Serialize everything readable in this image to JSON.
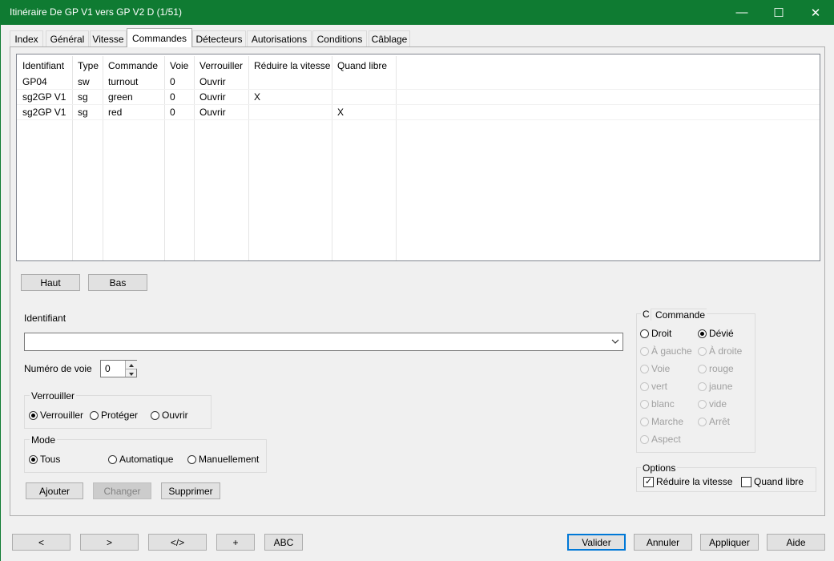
{
  "window": {
    "title": "Itinéraire  De GP V1 vers GP V2 D (1/51)",
    "minimize": "—",
    "maximize": "☐",
    "close": "✕"
  },
  "tabs": [
    {
      "label": "Index"
    },
    {
      "label": "Général"
    },
    {
      "label": "Vitesse"
    },
    {
      "label": "Commandes"
    },
    {
      "label": "Détecteurs"
    },
    {
      "label": "Autorisations"
    },
    {
      "label": "Conditions"
    },
    {
      "label": "Câblage"
    }
  ],
  "table": {
    "headers": [
      "Identifiant",
      "Type",
      "Commande",
      "Voie",
      "Verrouiller",
      "Réduire la vitesse",
      "Quand libre"
    ],
    "rows": [
      [
        "GP04",
        "sw",
        "turnout",
        "0",
        "Ouvrir",
        "",
        ""
      ],
      [
        "sg2GP V1",
        "sg",
        "green",
        "0",
        "Ouvrir",
        "X",
        ""
      ],
      [
        "sg2GP V1",
        "sg",
        "red",
        "0",
        "Ouvrir",
        "",
        "X"
      ]
    ]
  },
  "order_buttons": {
    "up": "Haut",
    "down": "Bas"
  },
  "form": {
    "identifiant_label": "Identifiant",
    "identifiant_value": "",
    "voie_label": "Numéro de voie",
    "voie_value": "0"
  },
  "verrouiller": {
    "title": "Verrouiller",
    "options": [
      "Verrouiller",
      "Protéger",
      "Ouvrir"
    ],
    "selected": "Verrouiller"
  },
  "mode": {
    "title": "Mode",
    "options": [
      "Tous",
      "Automatique",
      "Manuellement"
    ],
    "selected": "Tous"
  },
  "edit_buttons": {
    "add": "Ajouter",
    "change": "Changer",
    "delete": "Supprimer"
  },
  "commande": {
    "title_prefix": "C",
    "title": "Commande",
    "options": [
      {
        "label": "Droit",
        "enabled": true,
        "selected": false
      },
      {
        "label": "Dévié",
        "enabled": true,
        "selected": true
      },
      {
        "label": "À gauche",
        "enabled": false,
        "selected": false
      },
      {
        "label": "À droite",
        "enabled": false,
        "selected": false
      },
      {
        "label": "Voie",
        "enabled": false,
        "selected": false
      },
      {
        "label": "rouge",
        "enabled": false,
        "selected": false
      },
      {
        "label": "vert",
        "enabled": false,
        "selected": false
      },
      {
        "label": "jaune",
        "enabled": false,
        "selected": false
      },
      {
        "label": "blanc",
        "enabled": false,
        "selected": false
      },
      {
        "label": "vide",
        "enabled": false,
        "selected": false
      },
      {
        "label": "Marche",
        "enabled": false,
        "selected": false
      },
      {
        "label": "Arrêt",
        "enabled": false,
        "selected": false
      },
      {
        "label": "Aspect",
        "enabled": false,
        "selected": false
      }
    ]
  },
  "options": {
    "title": "Options",
    "reduce_speed": {
      "label": "Réduire la vitesse",
      "checked": true
    },
    "when_free": {
      "label": "Quand libre",
      "checked": false
    }
  },
  "nav_buttons": {
    "prev": "<",
    "next": ">",
    "code": "</>",
    "add": "+",
    "abc": "ABC"
  },
  "dialog_buttons": {
    "ok": "Valider",
    "cancel": "Annuler",
    "apply": "Appliquer",
    "help": "Aide"
  },
  "colors": {
    "titlebar": "#0f7b32",
    "accent": "#0078d7"
  }
}
